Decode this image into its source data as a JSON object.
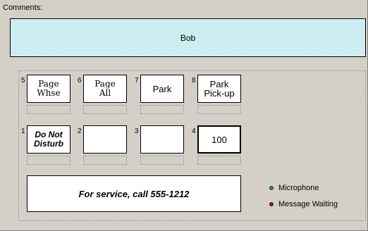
{
  "comments": {
    "label": "Comments:",
    "value": "Bob"
  },
  "keys": [
    {
      "number": "5",
      "label": "Page\nWhse",
      "style": "serif"
    },
    {
      "number": "6",
      "label": "Page\nAll",
      "style": "serif"
    },
    {
      "number": "7",
      "label": "Park",
      "style": "sans"
    },
    {
      "number": "8",
      "label": "Park\nPick-up",
      "style": "sans"
    },
    {
      "number": "1",
      "label": "Do Not\nDisturb",
      "style": "bolditalic"
    },
    {
      "number": "2",
      "label": "",
      "style": "sans"
    },
    {
      "number": "3",
      "label": "",
      "style": "sans"
    },
    {
      "number": "4",
      "label": "100",
      "style": "sans",
      "selected": true
    }
  ],
  "service": {
    "text": "For service, call 555-1212"
  },
  "legend": {
    "microphone": {
      "label": "Microphone",
      "color": "#2e8b2e"
    },
    "message_waiting": {
      "label": "Message Waiting",
      "color": "#8b1a1a"
    }
  }
}
